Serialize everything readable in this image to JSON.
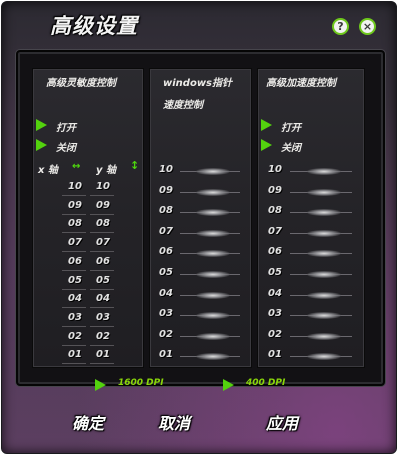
{
  "window": {
    "title": "高级设置"
  },
  "header": {
    "help_icon": "question-icon",
    "close_icon": "close-icon",
    "help_glyph": "?",
    "close_glyph": "×"
  },
  "sensitivity": {
    "title": "高级灵敏度控制",
    "on_label": "打开",
    "off_label": "关闭",
    "x_axis": "x 轴",
    "y_axis": "y 轴",
    "lr_arrow": "↔",
    "ud_arrow": "↕",
    "levels": [
      "10",
      "09",
      "08",
      "07",
      "06",
      "05",
      "04",
      "03",
      "02",
      "01"
    ]
  },
  "pointer": {
    "title_line1": "windows指针",
    "title_line2": "速度控制",
    "levels": [
      "10",
      "09",
      "08",
      "07",
      "06",
      "05",
      "04",
      "03",
      "02",
      "01"
    ]
  },
  "acceleration": {
    "title": "高级加速度控制",
    "on_label": "打开",
    "off_label": "关闭",
    "levels": [
      "10",
      "09",
      "08",
      "07",
      "06",
      "05",
      "04",
      "03",
      "02",
      "01"
    ]
  },
  "dpi": {
    "option1": "1600 DPI",
    "option2": "400 DPI"
  },
  "footer": {
    "ok": "确定",
    "cancel": "取消",
    "apply": "应用"
  },
  "colors": {
    "accent_green": "#53d20e",
    "dpi_text": "#8ad70a"
  }
}
